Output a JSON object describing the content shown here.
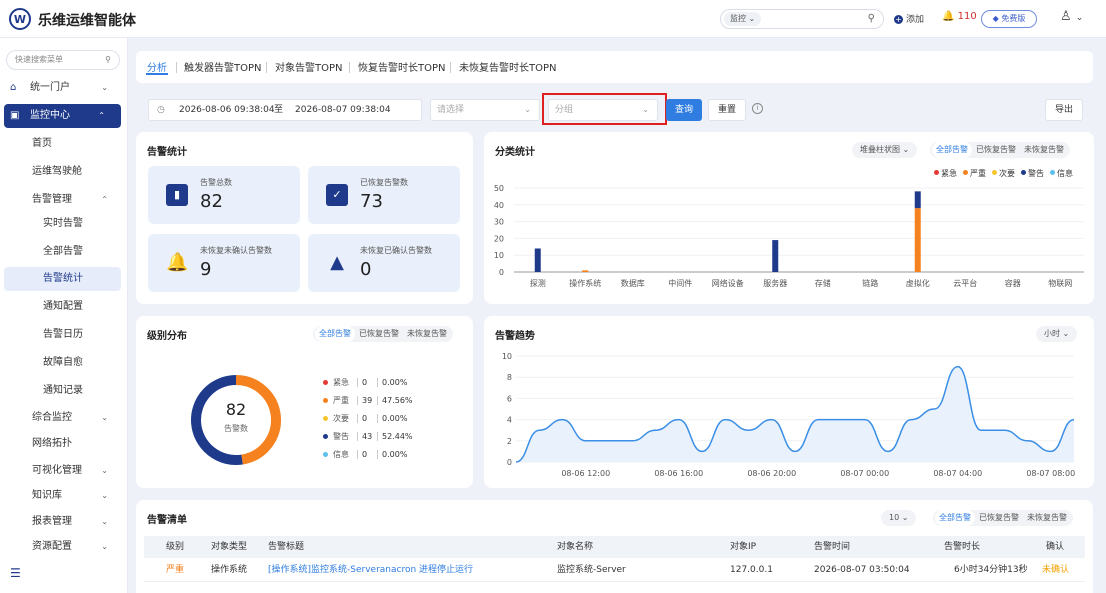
{
  "app": {
    "title": "乐维运维智能体",
    "logo": "W"
  },
  "topbar": {
    "search_scope": "监控",
    "add_label": "添加",
    "alarm_count": "110",
    "edition": "免费版"
  },
  "sidebar": {
    "search_placeholder": "快速搜索菜单",
    "items": [
      {
        "label": "统一门户"
      },
      {
        "label": "监控中心"
      },
      {
        "label": "首页"
      },
      {
        "label": "运维驾驶舱"
      },
      {
        "label": "告警管理"
      },
      {
        "label": "实时告警"
      },
      {
        "label": "全部告警"
      },
      {
        "label": "告警统计"
      },
      {
        "label": "通知配置"
      },
      {
        "label": "告警日历"
      },
      {
        "label": "故障自愈"
      },
      {
        "label": "通知记录"
      },
      {
        "label": "综合监控"
      },
      {
        "label": "网络拓扑"
      },
      {
        "label": "可视化管理"
      },
      {
        "label": "知识库"
      },
      {
        "label": "报表管理"
      },
      {
        "label": "资源配置"
      }
    ]
  },
  "tabs": [
    {
      "label": "分析"
    },
    {
      "label": "触发器告警TOPN"
    },
    {
      "label": "对象告警TOPN"
    },
    {
      "label": "恢复告警时长TOPN"
    },
    {
      "label": "未恢复告警时长TOPN"
    }
  ],
  "filter": {
    "start": "2026-08-06 09:38:04",
    "sep": "至",
    "end": "2026-08-07 09:38:04",
    "select_placeholder": "请选择",
    "group_placeholder": "分组",
    "query": "查询",
    "reset": "重置",
    "export": "导出"
  },
  "stats": {
    "title": "告警统计",
    "items": [
      {
        "label": "告警总数",
        "value": "82"
      },
      {
        "label": "已恢复告警数",
        "value": "73"
      },
      {
        "label": "未恢复未确认告警数",
        "value": "9"
      },
      {
        "label": "未恢复已确认告警数",
        "value": "0"
      }
    ]
  },
  "seg": {
    "all": "全部告警",
    "recovered": "已恢复告警",
    "unrecovered": "未恢复告警"
  },
  "classify": {
    "title": "分类统计",
    "chart_kind": "堆叠柱状图"
  },
  "level": {
    "title": "级别分布",
    "center_value": "82",
    "center_label": "告警数",
    "rows": [
      {
        "name": "紧急",
        "count": "0",
        "pct": "0.00%",
        "color": "#e53935"
      },
      {
        "name": "严重",
        "count": "39",
        "pct": "47.56%",
        "color": "#f5821f"
      },
      {
        "name": "次要",
        "count": "0",
        "pct": "0.00%",
        "color": "#f7c52e"
      },
      {
        "name": "警告",
        "count": "43",
        "pct": "52.44%",
        "color": "#1f3a8a"
      },
      {
        "name": "信息",
        "count": "0",
        "pct": "0.00%",
        "color": "#5bc0eb"
      }
    ]
  },
  "trend": {
    "title": "告警趋势",
    "granularity": "小时"
  },
  "list": {
    "title": "告警清单",
    "page_size": "10",
    "headers": [
      "级别",
      "对象类型",
      "告警标题",
      "对象名称",
      "对象IP",
      "告警时间",
      "告警时长",
      "确认"
    ],
    "rows": [
      [
        "严重",
        "操作系统",
        "[操作系统]监控系统-Serveranacron 进程停止运行",
        "监控系统-Server",
        "127.0.0.1",
        "2026-08-07 03:50:04",
        "6小时34分钟13秒",
        "未确认"
      ]
    ]
  },
  "chart_data": [
    {
      "type": "bar",
      "stacked": true,
      "categories": [
        "探测",
        "操作系统",
        "数据库",
        "中间件",
        "网络设备",
        "服务器",
        "存储",
        "链路",
        "虚拟化",
        "云平台",
        "容器",
        "物联网"
      ],
      "series": [
        {
          "name": "紧急",
          "color": "#e53935",
          "values": [
            0,
            0,
            0,
            0,
            0,
            0,
            0,
            0,
            0,
            0,
            0,
            0
          ]
        },
        {
          "name": "严重",
          "color": "#f5821f",
          "values": [
            0,
            1,
            0,
            0,
            0,
            0,
            0,
            0,
            38,
            0,
            0,
            0
          ]
        },
        {
          "name": "次要",
          "color": "#f7c52e",
          "values": [
            0,
            0,
            0,
            0,
            0,
            0,
            0,
            0,
            0,
            0,
            0,
            0
          ]
        },
        {
          "name": "警告",
          "color": "#1f3a8a",
          "values": [
            14,
            0,
            0,
            0,
            0,
            19,
            0,
            0,
            10,
            0,
            0,
            0
          ]
        },
        {
          "name": "信息",
          "color": "#5bc0eb",
          "values": [
            0,
            0,
            0,
            0,
            0,
            0,
            0,
            0,
            0,
            0,
            0,
            0
          ]
        }
      ],
      "ylim": [
        0,
        50
      ],
      "yticks": [
        0,
        10,
        20,
        30,
        40,
        50
      ],
      "legend": "top-right",
      "grid": true
    },
    {
      "type": "pie",
      "donut": true,
      "labels": [
        "严重",
        "警告"
      ],
      "values": [
        39,
        43
      ],
      "colors": [
        "#f5821f",
        "#1f3a8a"
      ]
    },
    {
      "type": "area",
      "x": [
        "08-06 09:00",
        "08-06 10:00",
        "08-06 11:00",
        "08-06 12:00",
        "08-06 13:00",
        "08-06 14:00",
        "08-06 15:00",
        "08-06 16:00",
        "08-06 17:00",
        "08-06 18:00",
        "08-06 19:00",
        "08-06 20:00",
        "08-06 21:00",
        "08-06 22:00",
        "08-06 23:00",
        "08-07 00:00",
        "08-07 01:00",
        "08-07 02:00",
        "08-07 03:00",
        "08-07 04:00",
        "08-07 05:00",
        "08-07 06:00",
        "08-07 07:00",
        "08-07 08:00",
        "08-07 09:00"
      ],
      "values": [
        0,
        3,
        4,
        2,
        2,
        2,
        3,
        4,
        1,
        4,
        3,
        4,
        1,
        4,
        4,
        4,
        1,
        4,
        5,
        9,
        3,
        3,
        2,
        1,
        4
      ],
      "xticks": [
        "08-06 12:00",
        "08-06 16:00",
        "08-06 20:00",
        "08-07 00:00",
        "08-07 04:00",
        "08-07 08:00"
      ],
      "ylim": [
        0,
        10
      ],
      "yticks": [
        0,
        2,
        4,
        6,
        8,
        10
      ],
      "color": "#3a8ee6",
      "grid": true
    }
  ]
}
